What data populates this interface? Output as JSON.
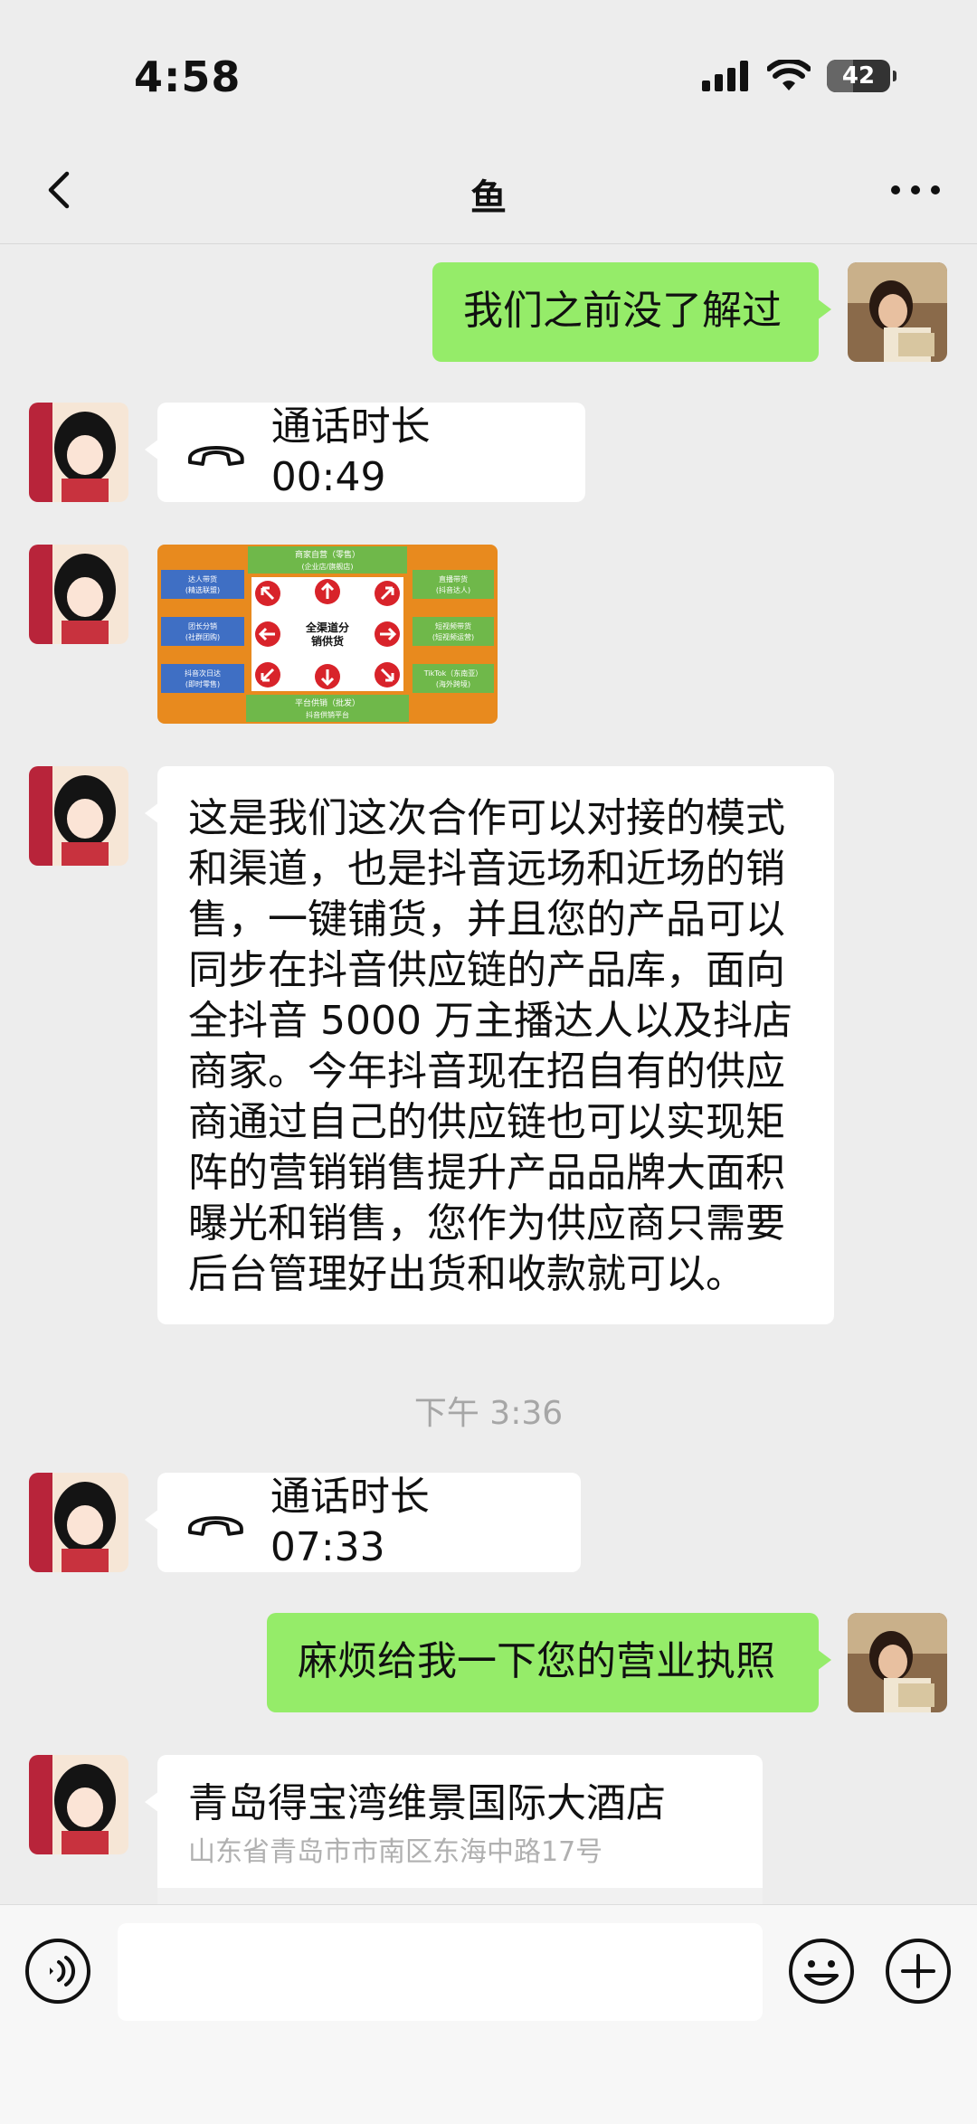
{
  "status_bar": {
    "time": "4:58",
    "battery": "42"
  },
  "nav": {
    "title": "鱼"
  },
  "messages": {
    "m1": {
      "text": "我们之前没了解过"
    },
    "m2": {
      "label": "通话时长 00:49"
    },
    "m3": {
      "image_alt": "全渠道分销供货",
      "top": "商家自营（零售）\n(企业店/旗舰店)",
      "left1": "达人带货\n(精选联盟)",
      "left2": "团长分销\n(社群团购)",
      "left3": "抖音次日达\n(即时零售)",
      "right1": "直播带货\n(抖音达人)",
      "right2": "短视频带货\n(短视频运营)",
      "right3": "TikTok（东南亚）\n(海外跨境)",
      "bottom": "平台供销（批发）\n抖音供销平台",
      "center": "全渠道分\n销供货"
    },
    "m4": {
      "lines": [
        "这是我们这次合作可以对接的模式",
        "和渠道，也是抖音远场和近场的销",
        "售，一键铺货，并且您的产品可以",
        "同步在抖音供应链的产品库，面向",
        "全抖音 5000 万主播达人以及抖店",
        "商家。今年抖音现在招自有的供应",
        "商通过自己的供应链也可以实现矩",
        "阵的营销销售提升产品品牌大面积",
        "曝光和销售，您作为供应商只需要",
        "后台管理好出货和收款就可以。"
      ]
    },
    "timestamp": "下午 3:36",
    "m5": {
      "label": "通话时长 07:33"
    },
    "m6": {
      "text": "麻烦给我一下您的营业执照"
    },
    "m7": {
      "title": "青岛得宝湾维景国际大酒店",
      "address": "山东省青岛市市南区东海中路17号"
    }
  },
  "colors": {
    "sent_bubble": "#95ec69",
    "received_bubble": "#ffffff",
    "background": "#ededed"
  },
  "icons": {
    "back": "chevron-left-icon",
    "more": "more-dots-icon",
    "voice": "voice-icon",
    "emoji": "emoji-icon",
    "add": "plus-icon",
    "call": "phone-icon"
  }
}
